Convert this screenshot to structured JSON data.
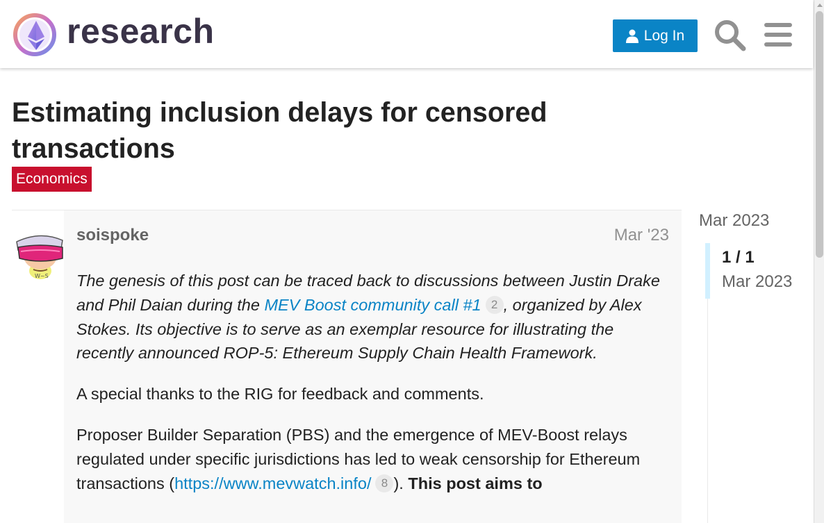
{
  "header": {
    "logo_text": "research",
    "login_label": "Log In",
    "accent_color": "#0a84c6"
  },
  "topic": {
    "title": "Estimating inclusion delays for censored transactions",
    "category": "Economics",
    "category_color": "#c8102e"
  },
  "post": {
    "author": "soispoke",
    "date": "Mar '23",
    "p1_before_link": "The genesis of this post can be traced back to discussions between Justin Drake and Phil Daian during the ",
    "p1_link": "MEV Boost community call #1",
    "p1_link_count": "2",
    "p1_after_link": ", organized by Alex Stokes. Its objective is to serve as an exemplar resource for illustrating the recently announced ROP-5: Ethereum Supply Chain Health Framework.",
    "p2": "A special thanks to the RIG for feedback and comments.",
    "p3_before_link": "Proposer Builder Separation (PBS) and the emergence of MEV-Boost relays regulated under specific jurisdictions has led to weak censorship for Ethereum transactions (",
    "p3_link": "https://www.mevwatch.info/",
    "p3_link_count": "8",
    "p3_after_link": "). ",
    "p3_bold": "This post aims to"
  },
  "timeline": {
    "start_label": "Mar 2023",
    "position": "1 / 1",
    "current_date": "Mar 2023"
  },
  "icons": [
    "user-icon",
    "search-icon",
    "hamburger-menu-icon",
    "logo-icon",
    "avatar"
  ]
}
